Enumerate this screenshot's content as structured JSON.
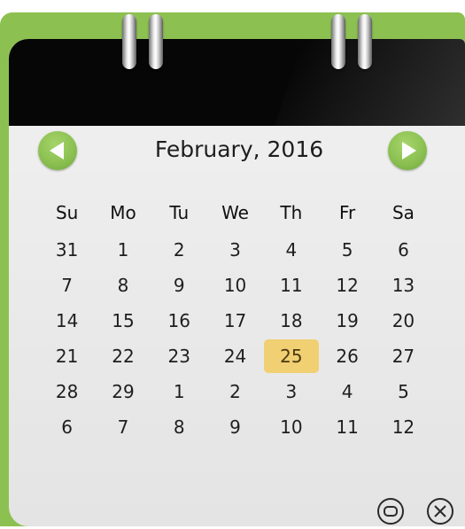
{
  "calendar": {
    "month_label": "February, 2016",
    "weekdays": [
      "Su",
      "Mo",
      "Tu",
      "We",
      "Th",
      "Fr",
      "Sa"
    ],
    "weeks": [
      [
        "31",
        "1",
        "2",
        "3",
        "4",
        "5",
        "6"
      ],
      [
        "7",
        "8",
        "9",
        "10",
        "11",
        "12",
        "13"
      ],
      [
        "14",
        "15",
        "16",
        "17",
        "18",
        "19",
        "20"
      ],
      [
        "21",
        "22",
        "23",
        "24",
        "25",
        "26",
        "27"
      ],
      [
        "28",
        "29",
        "1",
        "2",
        "3",
        "4",
        "5"
      ],
      [
        "6",
        "7",
        "8",
        "9",
        "10",
        "11",
        "12"
      ]
    ],
    "selected_day": "25",
    "prev_icon": "arrow-left-icon",
    "next_icon": "arrow-right-icon"
  },
  "controls": {
    "settings_icon": "settings-icon",
    "close_icon": "close-icon"
  },
  "colors": {
    "accent_green": "#8cc152",
    "highlight": "#f1cf73",
    "header_black": "#060606"
  }
}
